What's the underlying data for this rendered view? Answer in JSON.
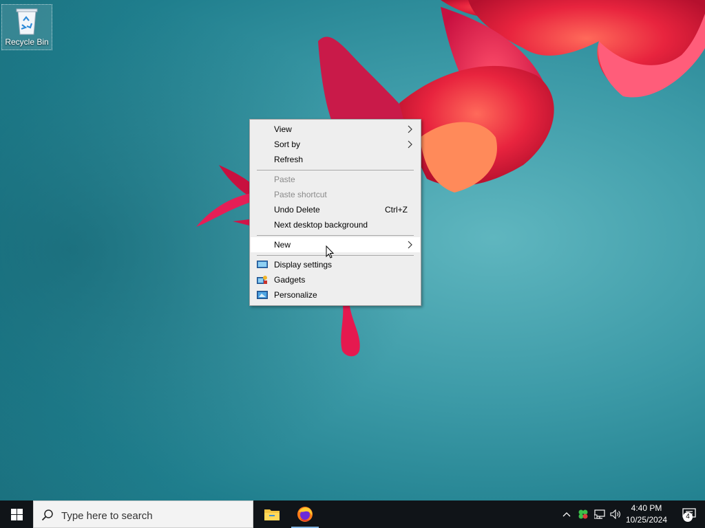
{
  "desktop": {
    "icons": [
      {
        "label": "Recycle Bin",
        "icon": "recycle-bin-icon"
      }
    ]
  },
  "context_menu": {
    "items": [
      {
        "label": "View",
        "submenu": true
      },
      {
        "label": "Sort by",
        "submenu": true
      },
      {
        "label": "Refresh"
      },
      {
        "label": "Paste",
        "disabled": true
      },
      {
        "label": "Paste shortcut",
        "disabled": true
      },
      {
        "label": "Undo Delete",
        "shortcut": "Ctrl+Z"
      },
      {
        "label": "Next desktop background"
      },
      {
        "label": "New",
        "submenu": true,
        "highlighted": true
      },
      {
        "label": "Display settings",
        "icon": "display-settings-icon"
      },
      {
        "label": "Gadgets",
        "icon": "gadgets-icon"
      },
      {
        "label": "Personalize",
        "icon": "personalize-icon"
      }
    ]
  },
  "taskbar": {
    "search_placeholder": "Type here to search",
    "pinned": [
      "file-explorer-icon",
      "firefox-icon"
    ],
    "clock": {
      "time": "4:40 PM",
      "date": "10/25/2024"
    },
    "notification_count": "4"
  },
  "colors": {
    "taskbar_bg": "#101418",
    "menu_bg": "#eeeeee",
    "menu_highlight": "#ffffff",
    "disabled_text": "#8a8a8a"
  }
}
